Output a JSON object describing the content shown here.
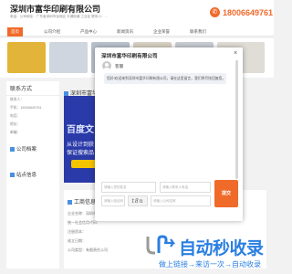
{
  "company": {
    "title": "深圳市富华印刷有限公司",
    "address_line": "电话：公司地址：广东省深圳市龙岗区 平湖街道 工业区 联系人：...",
    "phone": "18006649761"
  },
  "nav": [
    "首页",
    "公司介绍",
    "产品中心",
    "新闻资讯",
    "企业荣誉",
    "联系我们"
  ],
  "left_panel": {
    "contact_heading": "联系方式",
    "contact_lines": [
      "联系人：",
      "手机：18006649761",
      "电话：",
      "地址：",
      "邮编："
    ],
    "company_label": "公司档案",
    "site_label": "站点信息"
  },
  "middle": {
    "title": "深圳市富华印刷有",
    "ad_line1": "百度文",
    "ad_line2": "从设计到获",
    "ad_line3": "保证搜索品"
  },
  "tab_section": {
    "title": "工商信息",
    "rows": [
      "企业名称：深圳市富华印刷有限公司",
      "统一社会信用代码：",
      "注册资本：",
      "成立日期：",
      "公司类型：有限责任公司"
    ]
  },
  "dialog": {
    "title": "深圳市富华印刷有限公司",
    "close": "×",
    "agent_name": "客服",
    "greeting": "您好!欢迎来到深圳市富华印刷有限公司，请在这里留言，我们将尽快回复您。",
    "message_placeholder": "请输入您要咨询的内容...",
    "name_placeholder": "请输入您的姓名",
    "phone_placeholder": "请输入联系人电话",
    "company_placeholder": "请输入公司名称",
    "captcha_placeholder": "请输入验证码",
    "captcha_value": "t8n",
    "submit": "提交"
  },
  "watermark": {
    "brand": "自动秒收录",
    "tagline": "做上链接→来访一次→自动收录"
  },
  "colors": {
    "accent": "#f06a2a",
    "ad_blue": "#2a3aa8",
    "watermark_blue": "#2a7fe0"
  }
}
